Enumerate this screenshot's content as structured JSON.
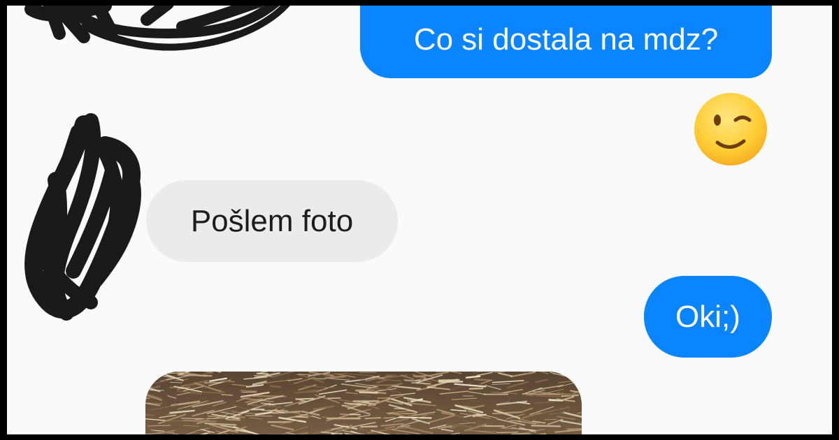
{
  "conversation": {
    "messages": [
      {
        "sender": "me",
        "type": "text",
        "text": "Co si dostala na mdz?"
      },
      {
        "sender": "me",
        "type": "emoji",
        "emoji": "winking-face"
      },
      {
        "sender": "contact",
        "type": "text",
        "text": "Pošlem foto"
      },
      {
        "sender": "me",
        "type": "text",
        "text": "Oki;)"
      },
      {
        "sender": "contact",
        "type": "photo",
        "photo": "dry-grass-photo"
      }
    ]
  },
  "colors": {
    "outgoing_bubble": "#0a84ff",
    "outgoing_text": "#ffffff",
    "incoming_bubble": "#ebebeb",
    "incoming_text": "#1c1c1c",
    "background": "#fafafa",
    "redaction": "#1a1a1a",
    "emoji_face": "#ffcc33"
  }
}
